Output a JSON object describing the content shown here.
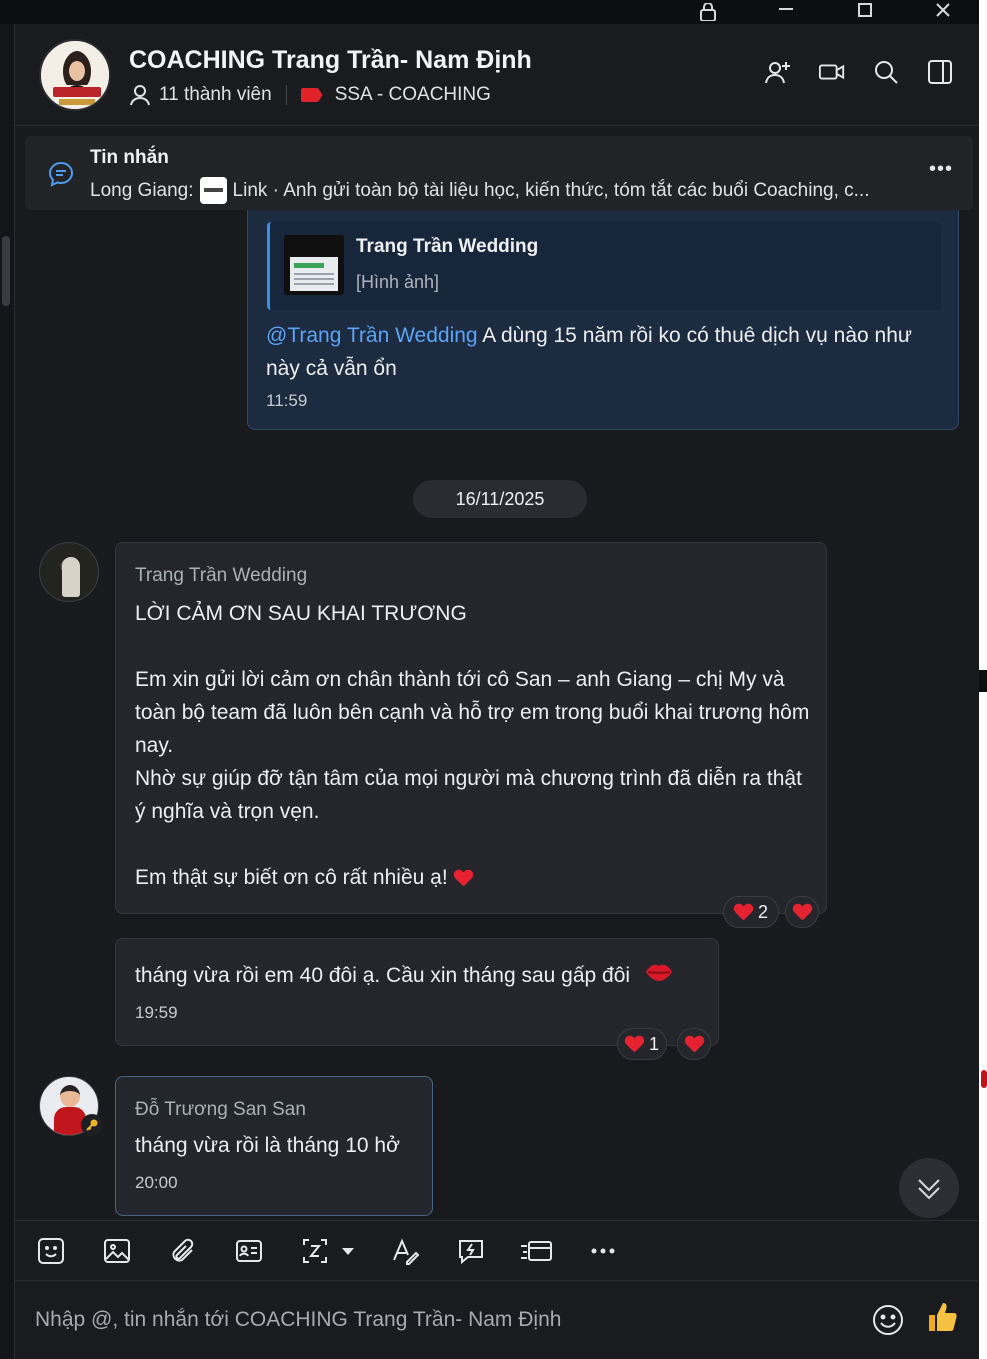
{
  "header": {
    "title": "COACHING Trang Trần- Nam Định",
    "members": "11 thành viên",
    "tag": "SSA - COACHING"
  },
  "pinned": {
    "title": "Tin nhắn",
    "sender": "Long Giang:",
    "link_label": "Link",
    "preview": "· Anh gửi toàn bộ tài liệu học, kiến thức, tóm tắt các buổi Coaching, c..."
  },
  "own_message": {
    "quote_name": "Trang Trần Wedding",
    "quote_type": "[Hình ảnh]",
    "mention": "@Trang Trần Wedding",
    "text": " A dùng 15 năm rồi ko có thuê dịch vụ nào như này cả vẫn ổn",
    "time": "11:59"
  },
  "date_separator": "16/11/2025",
  "messages": [
    {
      "sender": "Trang Trần Wedding",
      "text": "LỜI CẢM ƠN SAU KHAI TRƯƠNG\n\nEm xin gửi lời cảm ơn chân thành tới cô San – anh Giang – chị My và toàn bộ team đã luôn bên cạnh và hỗ trợ em trong buổi khai trương hôm nay.\nNhờ sự giúp đỡ tận tâm của mọi người mà chương trình đã diễn ra thật ý nghĩa và trọn vẹn.\n\nEm thật sự biết ơn cô rất nhiều ạ! ",
      "reaction_count": "2"
    },
    {
      "text": "tháng vừa rồi em 40 đôi ạ. Cầu xin tháng sau gấp đôi",
      "time": "19:59",
      "reaction_count": "1"
    },
    {
      "sender": "Đỗ Trương San San",
      "text": "tháng vừa rồi là tháng 10 hở",
      "time": "20:00"
    }
  ],
  "composer": {
    "placeholder": "Nhập @, tin nhắn tới COACHING Trang Trần- Nam Định"
  },
  "colors": {
    "accent": "#3b8ee8",
    "mention": "#5aa3f5",
    "heart": "#e5222f",
    "tag": "#e0232b"
  }
}
